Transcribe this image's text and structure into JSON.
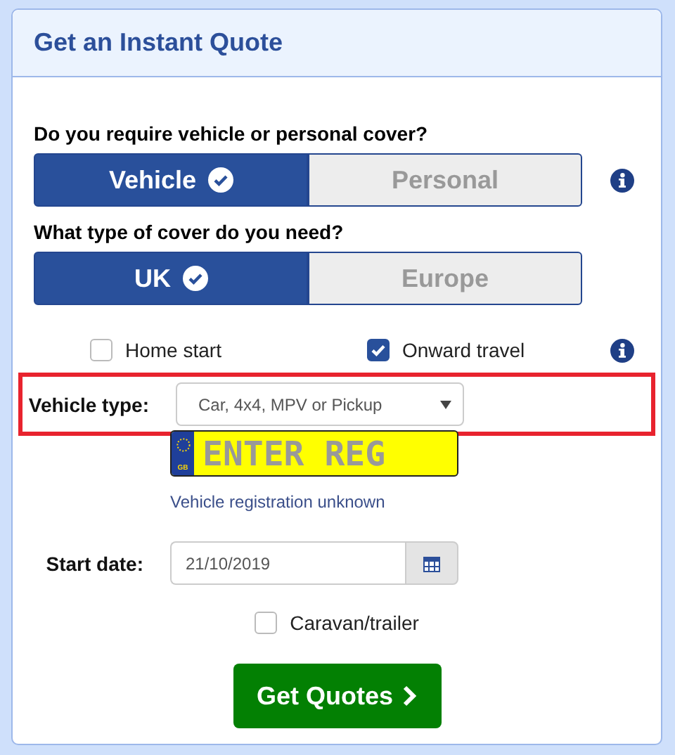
{
  "panel": {
    "title": "Get an Instant Quote"
  },
  "cover_question": {
    "label": "Do you require vehicle or personal cover?",
    "options": [
      {
        "label": "Vehicle",
        "selected": true
      },
      {
        "label": "Personal",
        "selected": false
      }
    ]
  },
  "region_question": {
    "label": "What type of cover do you need?",
    "options": [
      {
        "label": "UK",
        "selected": true
      },
      {
        "label": "Europe",
        "selected": false
      }
    ]
  },
  "extras": [
    {
      "label": "Home start",
      "checked": false
    },
    {
      "label": "Onward travel",
      "checked": true
    }
  ],
  "vehicle_type": {
    "label": "Vehicle type:",
    "value": "Car, 4x4, MPV or Pickup",
    "highlighted": true
  },
  "registration": {
    "placeholder": "ENTER REG",
    "country": "GB",
    "unknown_link": "Vehicle registration unknown"
  },
  "start_date": {
    "label": "Start date:",
    "value": "21/10/2019"
  },
  "caravan": {
    "label": "Caravan/trailer",
    "checked": false
  },
  "submit": {
    "label": "Get Quotes"
  }
}
